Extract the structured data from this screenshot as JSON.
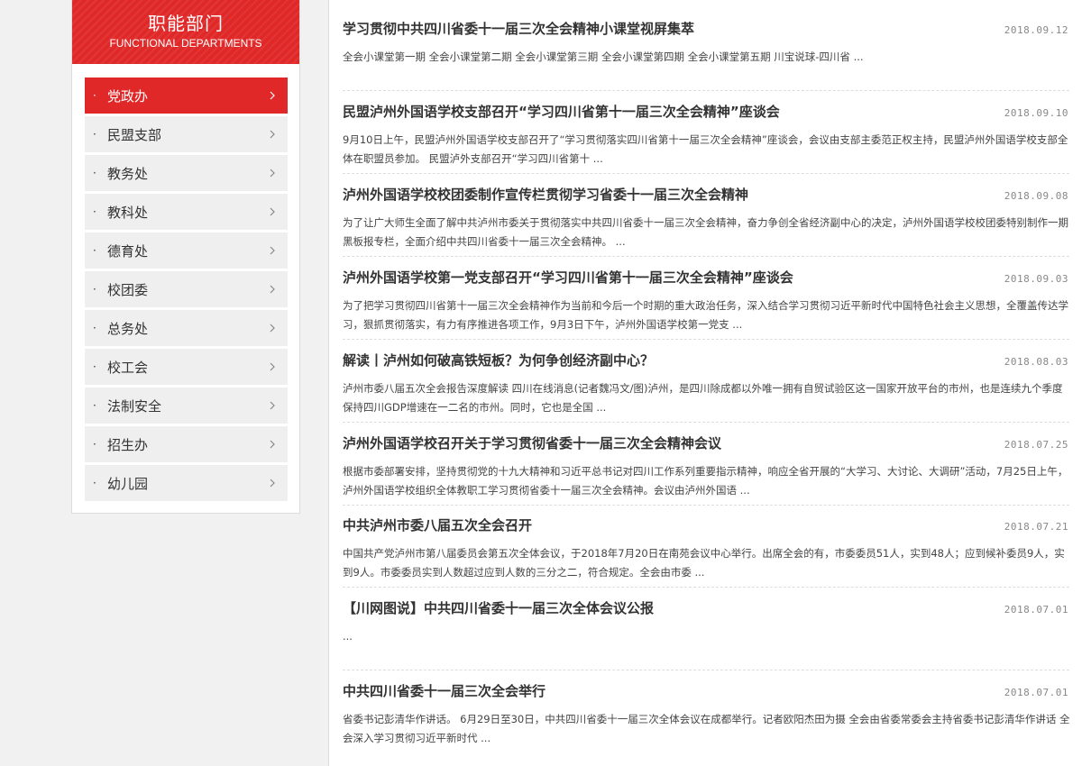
{
  "sidebar": {
    "title": "职能部门",
    "subtitle": "FUNCTIONAL DEPARTMENTS",
    "items": [
      {
        "label": "党政办"
      },
      {
        "label": "民盟支部"
      },
      {
        "label": "教务处"
      },
      {
        "label": "教科处"
      },
      {
        "label": "德育处"
      },
      {
        "label": "校团委"
      },
      {
        "label": "总务处"
      },
      {
        "label": "校工会"
      },
      {
        "label": "法制安全"
      },
      {
        "label": "招生办"
      },
      {
        "label": "幼儿园"
      }
    ],
    "bullet": "·",
    "active_index": 0
  },
  "articles": [
    {
      "title": "学习贯彻中共四川省委十一届三次全会精神小课堂视屏集萃",
      "date": "2018.09.12",
      "summary": "全会小课堂第一期 全会小课堂第二期 全会小课堂第三期 全会小课堂第四期 全会小课堂第五期 川宝说球-四川省 ..."
    },
    {
      "title": "民盟泸州外国语学校支部召开“学习四川省第十一届三次全会精神”座谈会",
      "date": "2018.09.10",
      "summary": "9月10日上午，民盟泸州外国语学校支部召开了“学习贯彻落实四川省第十一届三次全会精神”座谈会，会议由支部主委范正权主持，民盟泸州外国语学校支部全体在职盟员参加。 民盟泸外支部召开“学习四川省第十 ..."
    },
    {
      "title": "泸州外国语学校校团委制作宣传栏贯彻学习省委十一届三次全会精神",
      "date": "2018.09.08",
      "summary": "为了让广大师生全面了解中共泸州市委关于贯彻落实中共四川省委十一届三次全会精神，奋力争创全省经济副中心的决定，泸州外国语学校校团委特别制作一期黑板报专栏，全面介绍中共四川省委十一届三次全会精神。 ..."
    },
    {
      "title": "泸州外国语学校第一党支部召开“学习四川省第十一届三次全会精神”座谈会",
      "date": "2018.09.03",
      "summary": "为了把学习贯彻四川省第十一届三次全会精神作为当前和今后一个时期的重大政治任务，深入结合学习贯彻习近平新时代中国特色社会主义思想，全覆盖传达学习，狠抓贯彻落实，有力有序推进各项工作，9月3日下午，泸州外国语学校第一党支 ..."
    },
    {
      "title": "解读丨泸州如何破高铁短板？为何争创经济副中心？",
      "date": "2018.08.03",
      "summary": "泸州市委八届五次全会报告深度解读 四川在线消息(记者魏冯文/图)泸州，是四川除成都以外唯一拥有自贸试验区这一国家开放平台的市州，也是连续九个季度保持四川GDP增速在一二名的市州。同时，它也是全国 ..."
    },
    {
      "title": "泸州外国语学校召开关于学习贯彻省委十一届三次全会精神会议",
      "date": "2018.07.25",
      "summary": "根据市委部署安排，坚持贯彻党的十九大精神和习近平总书记对四川工作系列重要指示精神，响应全省开展的“大学习、大讨论、大调研”活动，7月25日上午，泸州外国语学校组织全体教职工学习贯彻省委十一届三次全会精神。会议由泸州外国语 ..."
    },
    {
      "title": "中共泸州市委八届五次全会召开",
      "date": "2018.07.21",
      "summary": "中国共产党泸州市第八届委员会第五次全体会议，于2018年7月20日在南苑会议中心举行。出席全会的有，市委委员51人，实到48人；应到候补委员9人，实到9人。市委委员实到人数超过应到人数的三分之二，符合规定。全会由市委 ..."
    },
    {
      "title": "【川网图说】中共四川省委十一届三次全体会议公报",
      "date": "2018.07.01",
      "summary": "..."
    },
    {
      "title": "中共四川省委十一届三次全会举行",
      "date": "2018.07.01",
      "summary": "省委书记彭清华作讲话。 6月29日至30日，中共四川省委十一届三次全体会议在成都举行。记者欧阳杰田为摄 全会由省委常委会主持省委书记彭清华作讲话 全会深入学习贯彻习近平新时代 ..."
    }
  ],
  "colors": {
    "accent": "#e02828",
    "menu_bg": "#efefef",
    "page_bg": "#f1f1f1"
  },
  "icons": {
    "menu_arrow": "chevron-right-icon"
  }
}
